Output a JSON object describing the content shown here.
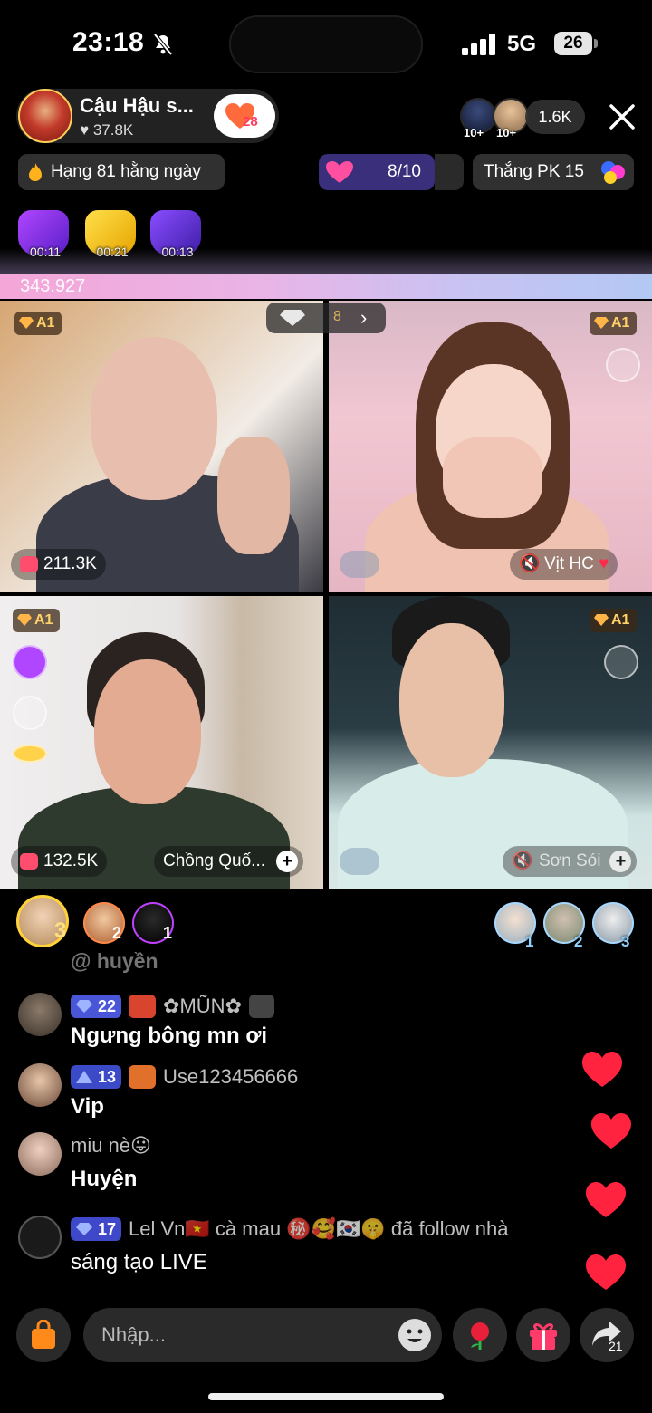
{
  "status_bar": {
    "time": "23:18",
    "network": "5G",
    "battery": "26"
  },
  "host": {
    "name": "Cậu Hậu s...",
    "likes": "37.8K",
    "follow_badge": "28"
  },
  "viewers": {
    "count": "1.6K",
    "badge1": "10+",
    "badge2": "10+"
  },
  "chips": {
    "rank": "Hạng 81 hằng ngày",
    "goal": "8/10",
    "pk": "Thắng PK 15"
  },
  "timers": [
    "00:11",
    "00:21",
    "00:13"
  ],
  "score": "343.927",
  "pk_center": {
    "num": "8"
  },
  "tiles": [
    {
      "badge": "A1",
      "score": "211.3K"
    },
    {
      "badge": "A1",
      "name": "Vịt HC"
    },
    {
      "badge": "A1",
      "score": "132.5K",
      "name": "Chồng Quố..."
    },
    {
      "badge": "A1",
      "name": "Sơn Sói"
    }
  ],
  "gifters": [
    {
      "rank": "3"
    },
    {
      "rank": "2"
    },
    {
      "rank": "1"
    }
  ],
  "ranks_right": [
    {
      "rank": "1"
    },
    {
      "rank": "2"
    },
    {
      "rank": "3"
    }
  ],
  "chat": {
    "faded": "@ huyền",
    "messages": [
      {
        "level": "22",
        "user": "✿MŨN✿",
        "text": "Ngưng bông mn ơi"
      },
      {
        "level": "13",
        "user": "Use123456666",
        "text": "Vip"
      },
      {
        "user": "miu nè😛",
        "text": "Huyện"
      },
      {
        "level": "17",
        "user": "Lel Vn🇻🇳 cà mau ㊙️🥰🇰🇷🤫 đã follow nhà",
        "text": "sáng tạo LIVE"
      }
    ]
  },
  "bottom": {
    "placeholder": "Nhập...",
    "share_count": "21"
  },
  "colors": {
    "accent_pink": "#ff3b5c",
    "goal_purple": "#3a2f7a",
    "rank_blue": "#8fd2ff"
  }
}
